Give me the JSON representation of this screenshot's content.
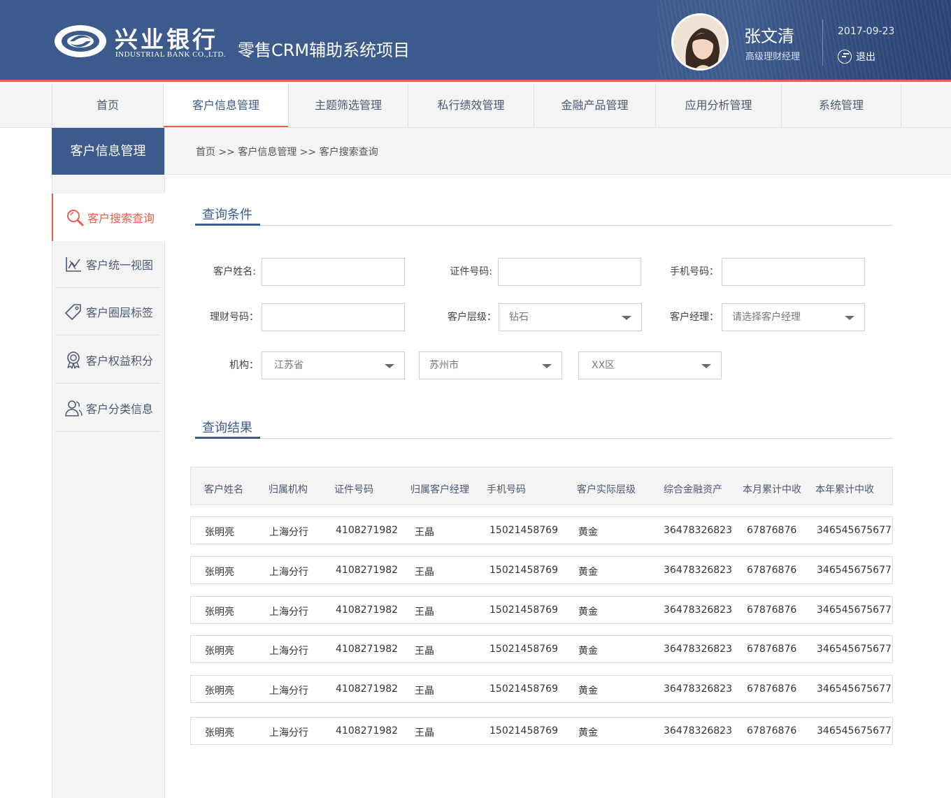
{
  "header": {
    "bank_name_cn": "兴业银行",
    "bank_name_en": "INDUSTRIAL BANK CO.,LTD.",
    "system_title": "零售CRM辅助系统项目",
    "user_name": "张文清",
    "user_role": "高级理财经理",
    "date": "2017-09-23",
    "logout_label": "退出"
  },
  "nav": {
    "items": [
      {
        "label": "首页"
      },
      {
        "label": "客户信息管理"
      },
      {
        "label": "主题筛选管理"
      },
      {
        "label": "私行绩效管理"
      },
      {
        "label": "金融产品管理"
      },
      {
        "label": "应用分析管理"
      },
      {
        "label": "系统管理"
      }
    ],
    "active_index": 1
  },
  "sidebar": {
    "title": "客户信息管理",
    "items": [
      {
        "label": "客户搜索查询",
        "icon": "search-icon"
      },
      {
        "label": "客户统一视图",
        "icon": "chart-icon"
      },
      {
        "label": "客户圈层标签",
        "icon": "tag-icon"
      },
      {
        "label": "客户权益积分",
        "icon": "badge-icon"
      },
      {
        "label": "客户分类信息",
        "icon": "users-icon"
      }
    ],
    "active_index": 0
  },
  "breadcrumb": "首页 >> 客户信息管理 >> 客户搜索查询",
  "query": {
    "title": "查询条件",
    "fields": {
      "name_label": "客户姓名:",
      "id_label": "证件号码:",
      "phone_label": "手机号码：",
      "wealth_label": "理财号码：",
      "level_label": "客户层级：",
      "level_value": "钻石",
      "manager_label": "客户经理：",
      "manager_placeholder": "请选择客户经理",
      "org_label": "机构：",
      "province_value": "江苏省",
      "city_value": "苏州市",
      "district_value": "XX区"
    }
  },
  "results": {
    "title": "查询结果",
    "columns": [
      "客户姓名",
      "归属机构",
      "证件号码",
      "归属客户经理",
      "手机号码",
      "客户实际层级",
      "综合金融资产",
      "本月累计中收",
      "本年累计中收"
    ],
    "rows": [
      [
        "张明亮",
        "上海分行",
        "4108271982",
        "王晶",
        "15021458769",
        "黄金",
        "36478326823",
        "67876876",
        "346545675677"
      ],
      [
        "张明亮",
        "上海分行",
        "4108271982",
        "王晶",
        "15021458769",
        "黄金",
        "36478326823",
        "67876876",
        "346545675677"
      ],
      [
        "张明亮",
        "上海分行",
        "4108271982",
        "王晶",
        "15021458769",
        "黄金",
        "36478326823",
        "67876876",
        "346545675677"
      ],
      [
        "张明亮",
        "上海分行",
        "4108271982",
        "王晶",
        "15021458769",
        "黄金",
        "36478326823",
        "67876876",
        "346545675677"
      ],
      [
        "张明亮",
        "上海分行",
        "4108271982",
        "王晶",
        "15021458769",
        "黄金",
        "36478326823",
        "67876876",
        "346545675677"
      ],
      [
        "张明亮",
        "上海分行",
        "4108271982",
        "王晶",
        "15021458769",
        "黄金",
        "36478326823",
        "67876876",
        "346545675677"
      ]
    ]
  },
  "colors": {
    "brand_blue": "#3c5a8c",
    "accent_red": "#e8604c"
  }
}
